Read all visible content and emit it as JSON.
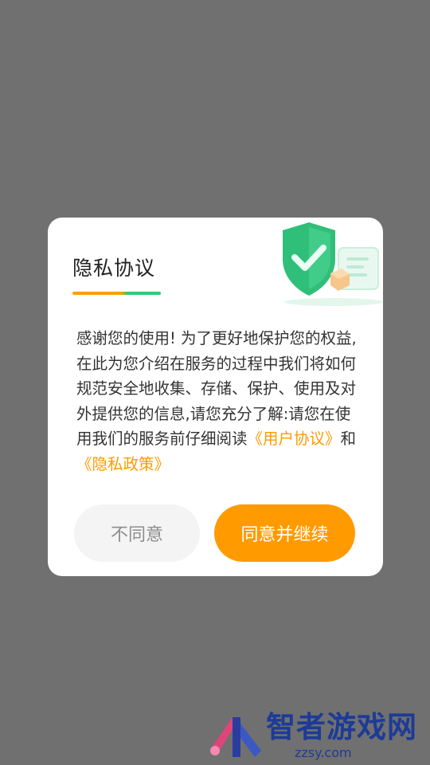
{
  "dialog": {
    "title": "隐私协议",
    "body": {
      "intro": "感谢您的使用! 为了更好地保护您的权益,在此为您介绍在服务的过程中我们将如何规范安全地收集、存储、保护、使用及对外提供您的信息,请您充分了解:请您在使用我们的服务前仔细阅读",
      "user_agreement_link": "《用户协议》",
      "conjunction": "和",
      "privacy_policy_link": "《隐私政策》"
    },
    "disagree_label": "不同意",
    "agree_label": "同意并继续",
    "illustration_icon": "shield-check-icon"
  },
  "watermark": {
    "site_name": "智者游戏网",
    "url": "zzsy.com"
  },
  "colors": {
    "accent": "#ff9b00",
    "shield_green": "#34c77b",
    "overlay": "#707070"
  }
}
